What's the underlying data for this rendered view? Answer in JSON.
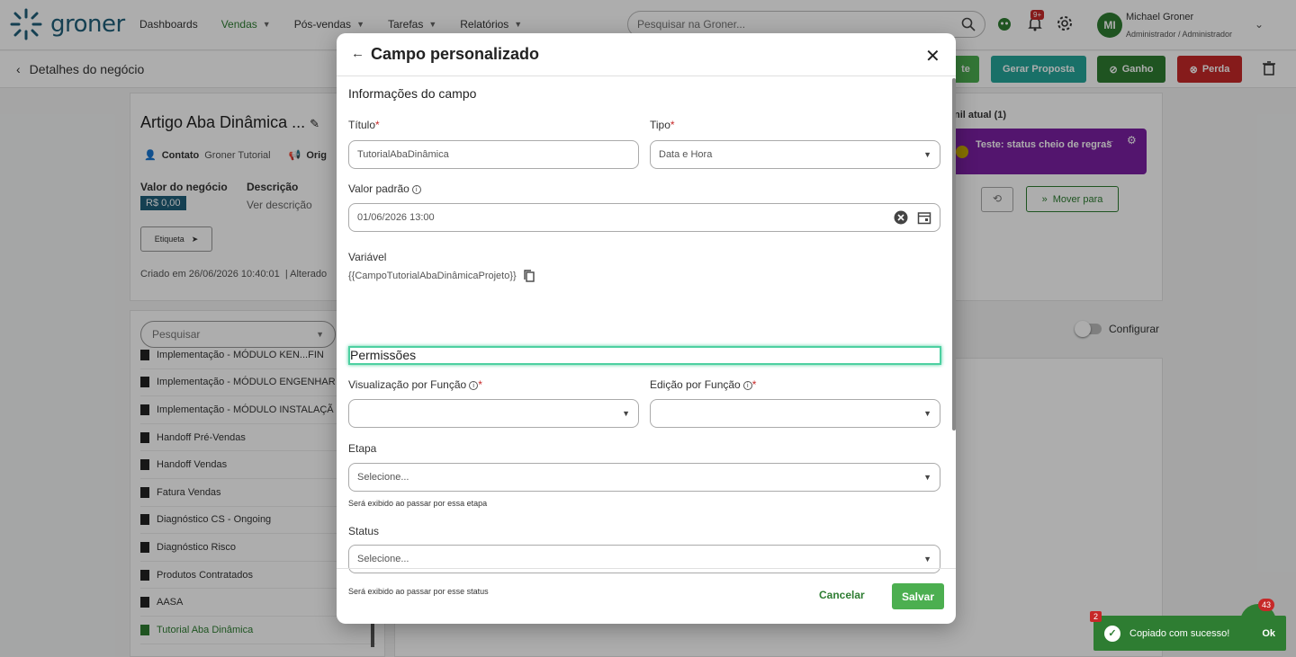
{
  "app": {
    "brand": "groner",
    "nav": [
      {
        "label": "Dashboards",
        "caret": false
      },
      {
        "label": "Vendas",
        "caret": true,
        "active": true
      },
      {
        "label": "Pós-vendas",
        "caret": true
      },
      {
        "label": "Tarefas",
        "caret": true
      },
      {
        "label": "Relatórios",
        "caret": true
      }
    ],
    "search_placeholder": "Pesquisar na Groner...",
    "notif_badge": "9+",
    "user": {
      "initials": "MI",
      "name": "Michael Groner",
      "role": "Administrador / Administrador"
    }
  },
  "subheader": {
    "title": "Detalhes do negócio",
    "buttons": {
      "partial": "te",
      "proposta": "Gerar Proposta",
      "ganho": "Ganho",
      "perda": "Perda"
    }
  },
  "deal": {
    "title": "Artigo Aba Dinâmica ...",
    "contact_label": "Contato",
    "contact_value": "Groner Tutorial",
    "origin_label": "Orig",
    "value_label": "Valor do negócio",
    "value": "R$ 0,00",
    "desc_label": "Descrição",
    "desc_value": "Ver descrição",
    "tag_label": "Etiqueta",
    "created": "Criado em 26/06/2026 10:40:01",
    "altered": "Alterado"
  },
  "left_list": {
    "search_placeholder": "Pesquisar",
    "items": [
      {
        "label": "Implementação - MÓDULO KEN...FIN",
        "active": false
      },
      {
        "label": "Implementação - MÓDULO ENGENHAR",
        "active": false
      },
      {
        "label": "Implementação - MÓDULO INSTALAÇÃ",
        "active": false
      },
      {
        "label": "Handoff Pré-Vendas",
        "active": false
      },
      {
        "label": "Handoff Vendas",
        "active": false
      },
      {
        "label": "Fatura Vendas",
        "active": false
      },
      {
        "label": "Diagnóstico CS - Ongoing",
        "active": false
      },
      {
        "label": "Diagnóstico Risco",
        "active": false
      },
      {
        "label": "Produtos Contratados",
        "active": false
      },
      {
        "label": "AASA",
        "active": false
      },
      {
        "label": "Tutorial Aba Dinâmica",
        "active": true
      }
    ]
  },
  "funnel": {
    "label": "nil atual (1)",
    "status": "Teste: status cheio de regras",
    "move_button": "Mover para",
    "config_label": "Configurar"
  },
  "modal": {
    "title": "Campo personalizado",
    "section_info": "Informações do campo",
    "titulo_label": "Título",
    "titulo_value": "TutorialAbaDinâmica",
    "tipo_label": "Tipo",
    "tipo_value": "Data e Hora",
    "valor_padrao_label": "Valor padrão",
    "valor_padrao_value": "01/06/2026 13:00",
    "variavel_label": "Variável",
    "variavel_value": "{{CampoTutorialAbaDinâmicaProjeto}}",
    "section_perm": "Permissões",
    "visualizacao_label": "Visualização por Função",
    "edicao_label": "Edição por Função",
    "etapa_label": "Etapa",
    "etapa_placeholder": "Selecione...",
    "etapa_hint": "Será exibido ao passar por essa etapa",
    "status_label": "Status",
    "status_placeholder": "Selecione...",
    "status_hint": "Será exibido ao passar por esse status",
    "cancel": "Cancelar",
    "save": "Salvar"
  },
  "toast": {
    "count": "2",
    "message": "Copiado com sucesso!",
    "ok": "Ok",
    "chat_badge": "43"
  },
  "colors": {
    "brand_green": "#2e7d32",
    "brand_teal": "#1f5f7a",
    "proposal": "#26a69a",
    "perda": "#c62828",
    "status_purple": "#7b1fa2",
    "highlight": "#4dd0a1"
  }
}
